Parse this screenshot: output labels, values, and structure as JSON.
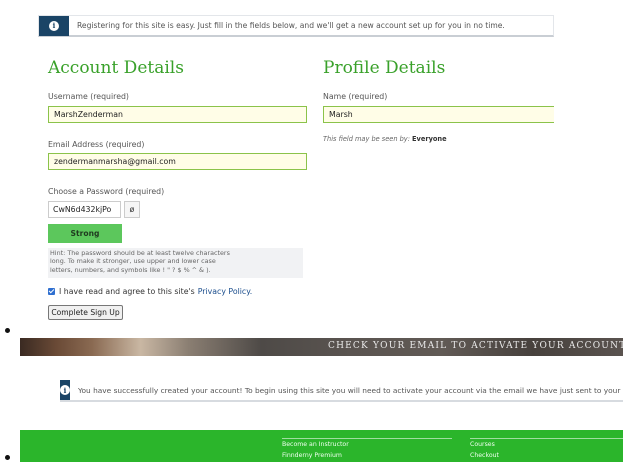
{
  "top_notice": {
    "icon": "info-icon",
    "text": "Registering for this site is easy. Just fill in the fields below, and we'll get a new account set up for you in no time."
  },
  "account": {
    "title": "Account Details",
    "username_label": "Username (required)",
    "username_value": "MarshZenderman",
    "email_label": "Email Address (required)",
    "email_value": "zendermanmarsha@gmail.com",
    "password_label": "Choose a Password (required)",
    "password_value": "CwN6d432kjPo",
    "toggle_icon": "eye-slash-icon",
    "strength_label": "Strong",
    "hint_lines": [
      "Hint: The password should be at least twelve characters",
      "long. To make it stronger, use upper and lower case",
      "letters, numbers, and symbols like ! \" ? $ % ^ & )."
    ]
  },
  "profile": {
    "title": "Profile Details",
    "name_label": "Name (required)",
    "name_value": "Marsh",
    "visibility_prefix": "This field may be seen by:",
    "visibility_value": "Everyone"
  },
  "agreement": {
    "text": "I have read and agree to this site's",
    "link": "Privacy Policy."
  },
  "submit_label": "Complete Sign Up",
  "hero_text": "CHECK YOUR EMAIL TO ACTIVATE YOUR ACCOUNT!",
  "success_notice": {
    "icon": "info-icon",
    "text": "You have successfully created your account! To begin using this site you will need to activate your account via the email we have just sent to your address."
  },
  "footer": {
    "left_links": [
      "Become an Instructor",
      "Finnderny Premium"
    ],
    "right_links": [
      "Courses",
      "Checkout"
    ]
  },
  "colors": {
    "accent_green": "#39a12a",
    "notice_icon_bg": "#1a4466",
    "strength_green": "#5cc75c",
    "footer_green": "#2bb52b"
  }
}
